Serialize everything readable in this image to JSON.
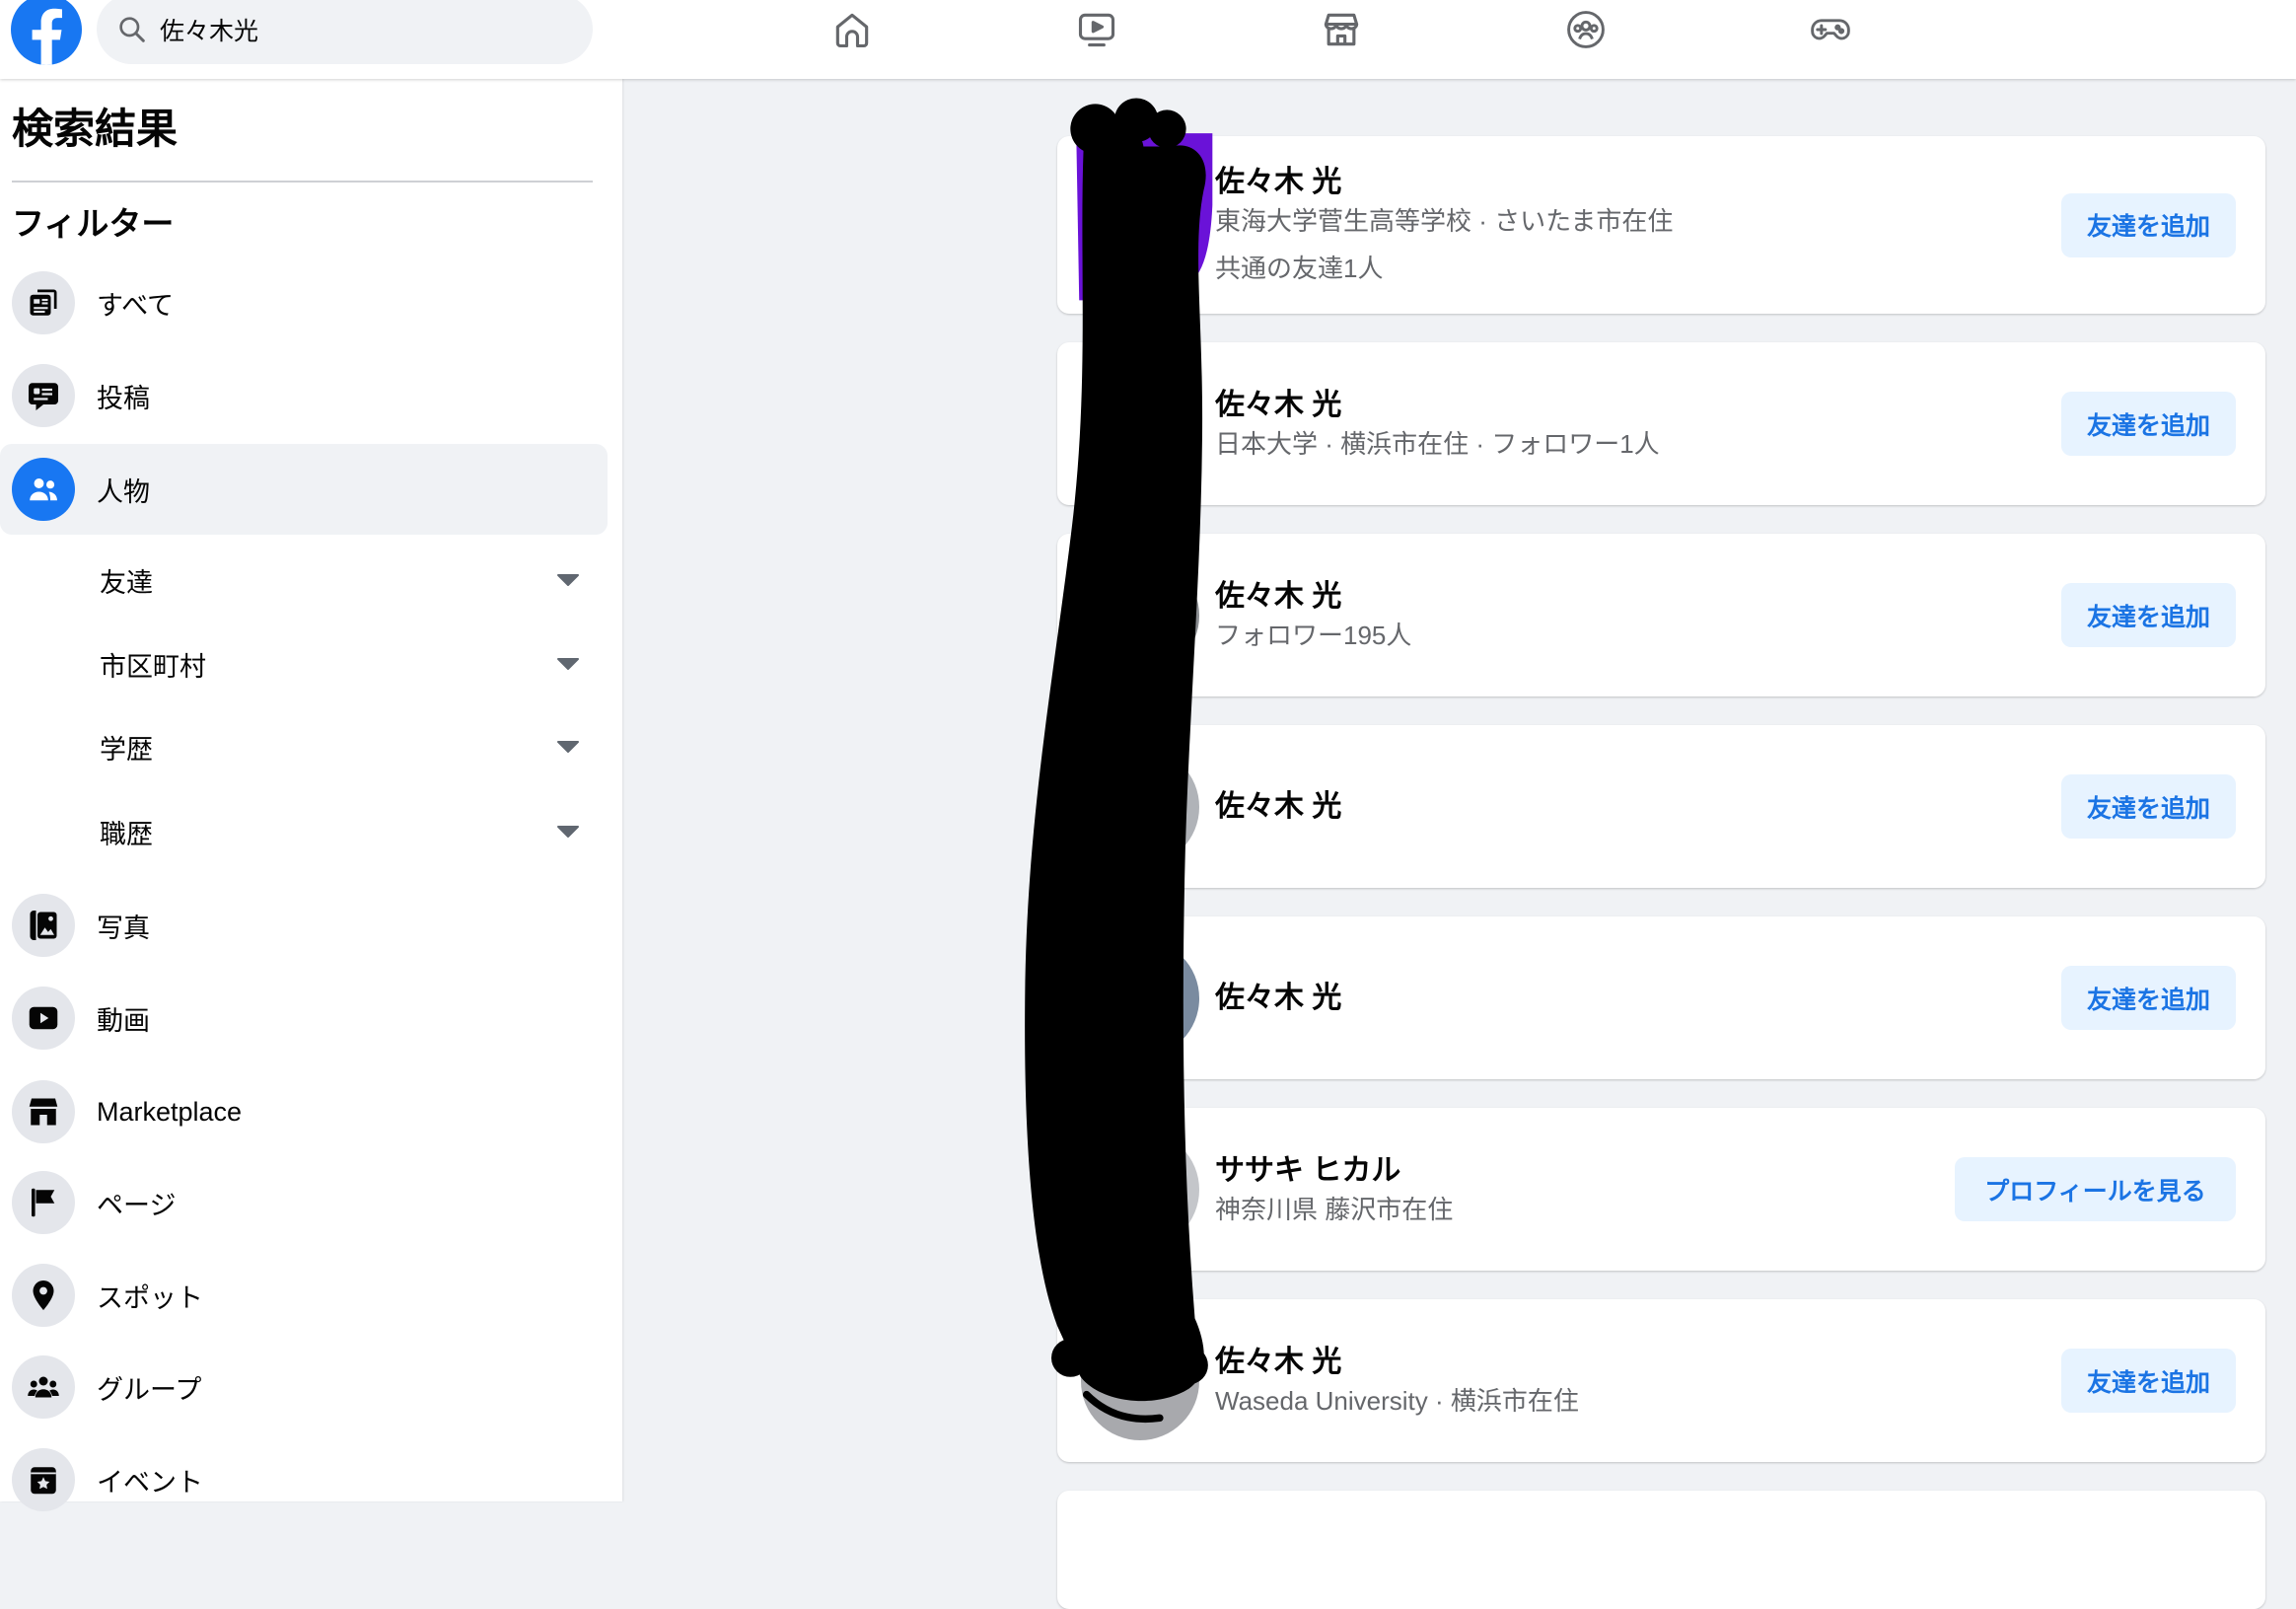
{
  "colors": {
    "accent": "#1877f2",
    "button_bg": "#e7f3ff",
    "button_text": "#1b74e4",
    "page_bg": "#f0f2f5",
    "text_primary": "#050505",
    "text_secondary": "#65676b",
    "redaction": "#000000"
  },
  "topbar": {
    "logo_icon": "facebook-logo",
    "search": {
      "icon": "search-icon",
      "value": "佐々木光"
    },
    "nav": [
      {
        "icon": "home-icon"
      },
      {
        "icon": "video-icon"
      },
      {
        "icon": "marketplace-icon"
      },
      {
        "icon": "groups-icon"
      },
      {
        "icon": "gaming-icon"
      }
    ]
  },
  "sidebar": {
    "title": "検索結果",
    "filter_heading": "フィルター",
    "items": [
      {
        "label": "すべて",
        "icon": "all-results-icon"
      },
      {
        "label": "投稿",
        "icon": "posts-icon"
      },
      {
        "label": "人物",
        "icon": "people-icon",
        "selected": true
      },
      {
        "label": "写真",
        "icon": "photos-icon"
      },
      {
        "label": "動画",
        "icon": "video-icon"
      },
      {
        "label": "Marketplace",
        "icon": "marketplace-icon"
      },
      {
        "label": "ページ",
        "icon": "flag-icon"
      },
      {
        "label": "スポット",
        "icon": "location-pin-icon"
      },
      {
        "label": "グループ",
        "icon": "groups-icon"
      },
      {
        "label": "イベント",
        "icon": "calendar-icon"
      }
    ],
    "people_filters": [
      {
        "label": "友達",
        "icon": "chevron-down-icon"
      },
      {
        "label": "市区町村",
        "icon": "chevron-down-icon"
      },
      {
        "label": "学歴",
        "icon": "chevron-down-icon"
      },
      {
        "label": "職歴",
        "icon": "chevron-down-icon"
      }
    ]
  },
  "results": [
    {
      "name": "佐々木 光",
      "details": [
        "東海大学菅生高等学校 · さいたま市在住",
        "共通の友達1人"
      ],
      "action": "友達を追加"
    },
    {
      "name": "佐々木 光",
      "details": [
        "日本大学 · 横浜市在住 · フォロワー1人"
      ],
      "action": "友達を追加"
    },
    {
      "name": "佐々木 光",
      "details": [
        "フォロワー195人"
      ],
      "action": "友達を追加"
    },
    {
      "name": "佐々木 光",
      "details": [],
      "action": "友達を追加"
    },
    {
      "name": "佐々木 光",
      "details": [],
      "action": "友達を追加"
    },
    {
      "name": "ササキ ヒカル",
      "details": [
        "神奈川県 藤沢市在住"
      ],
      "action": "プロフィールを見る"
    },
    {
      "name": "佐々木 光",
      "details": [
        "Waseda University · 横浜市在住"
      ],
      "action": "友達を追加"
    }
  ]
}
